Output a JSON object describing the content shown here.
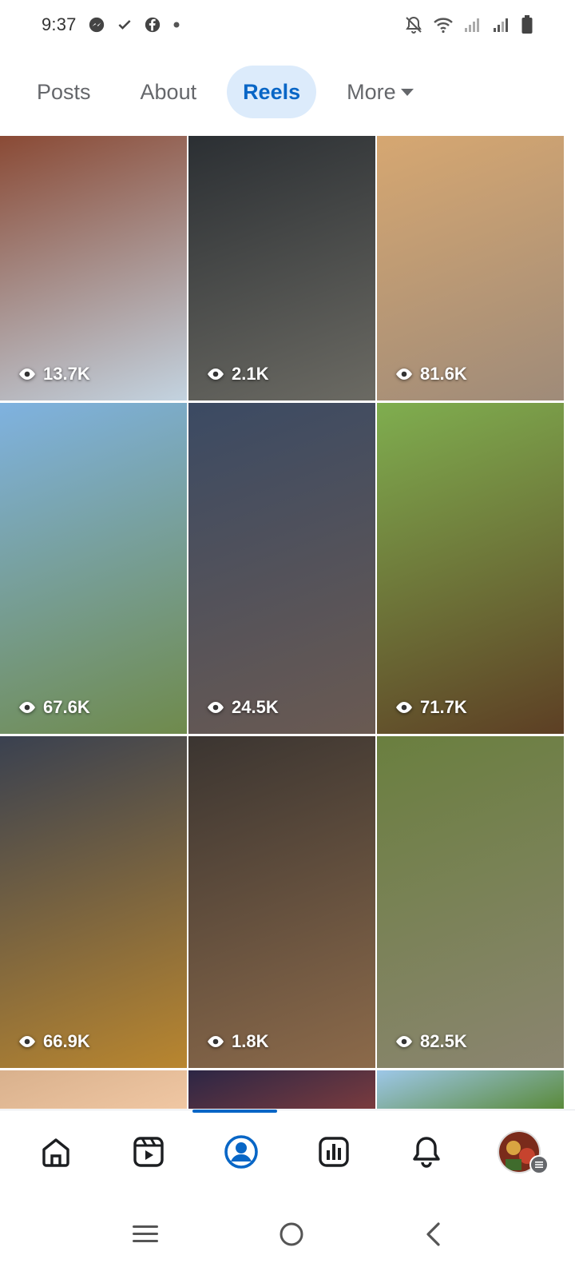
{
  "status_bar": {
    "time": "9:37",
    "left_icons": [
      "messenger-icon",
      "check-icon",
      "facebook-icon",
      "dot-icon"
    ],
    "right_icons": [
      "mute-icon",
      "wifi-icon",
      "signal-icon",
      "signal-icon",
      "battery-icon"
    ]
  },
  "tabs": [
    {
      "label": "Posts",
      "active": false
    },
    {
      "label": "About",
      "active": false
    },
    {
      "label": "Reels",
      "active": true
    },
    {
      "label": "More",
      "active": false
    }
  ],
  "reels": [
    {
      "views": "13.7K",
      "colors": [
        "#8a4a35",
        "#c3d3e0"
      ]
    },
    {
      "views": "2.1K",
      "colors": [
        "#2b2f33",
        "#6b6a63"
      ]
    },
    {
      "views": "81.6K",
      "colors": [
        "#d6a771",
        "#9f8b79"
      ]
    },
    {
      "views": "67.6K",
      "colors": [
        "#7fb2e0",
        "#6f8a4c"
      ]
    },
    {
      "views": "24.5K",
      "colors": [
        "#3b4a63",
        "#6a5a52"
      ]
    },
    {
      "views": "71.7K",
      "colors": [
        "#7fae4f",
        "#5d3f24"
      ]
    },
    {
      "views": "66.9K",
      "colors": [
        "#3a4150",
        "#b9862f"
      ]
    },
    {
      "views": "1.8K",
      "colors": [
        "#3b3531",
        "#8c6a4a"
      ]
    },
    {
      "views": "82.5K",
      "colors": [
        "#6a7f3f",
        "#8b8570"
      ]
    },
    {
      "views": "",
      "colors": [
        "#d9b18d",
        "#f0c7a3"
      ]
    },
    {
      "views": "",
      "colors": [
        "#2c2645",
        "#7a3b3e"
      ]
    },
    {
      "views": "",
      "colors": [
        "#9dc7e8",
        "#5a8a3a"
      ]
    }
  ],
  "bottom_nav": [
    {
      "name": "home-icon",
      "active": false
    },
    {
      "name": "reels-icon",
      "active": false
    },
    {
      "name": "profile-icon",
      "active": true
    },
    {
      "name": "dashboard-icon",
      "active": false
    },
    {
      "name": "notifications-icon",
      "active": false
    },
    {
      "name": "menu-avatar",
      "active": false
    }
  ],
  "system_nav": [
    "recents-icon",
    "home-circle-icon",
    "back-icon"
  ],
  "colors": {
    "accent": "#0866c6",
    "active_tab_bg": "#dcebfb",
    "inactive_text": "#65676b"
  }
}
